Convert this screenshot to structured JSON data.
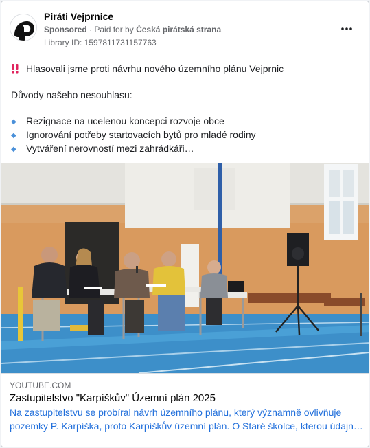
{
  "post": {
    "page_name": "Piráti Vejprnice",
    "sponsored_label": "Sponsored",
    "paid_for_prefix": "· Paid for by",
    "payer": "Česká pirátská strana",
    "library_id": "Library ID: 1597811731157763",
    "more_icon": "ellipsis-icon"
  },
  "body": {
    "headline": "Hlasovali jsme proti návrhu nového územního plánu Vejprnic",
    "headline_icon": "double-exclamation-icon",
    "reasons_intro": "Důvody našeho nesouhlasu:",
    "bullet_icon": "blue-diamond-icon",
    "reasons": [
      "Rezignace na ucelenou koncepci rozvoje obce",
      "Ignorování potřeby startovacích bytů pro mladé rodiny",
      "Vytváření nerovností mezi zahrádkáři…"
    ]
  },
  "link_card": {
    "domain": "YOUTUBE.COM",
    "title": "Zastupitelstvo \"Karpíškův\" Územní plán 2025",
    "description_line1": "Na zastupitelstvu se probíral návrh územního plánu, který významně ovlivňuje",
    "description_line2": "pozemky P. Karpíška, proto Karpíškův územní plán. O Staré školce, kterou údajně…"
  },
  "colors": {
    "accent_link": "#216fdb",
    "muted_text": "#65676b",
    "bullet_diamond": "#4a90d9",
    "exclamation": "#e0245e"
  }
}
